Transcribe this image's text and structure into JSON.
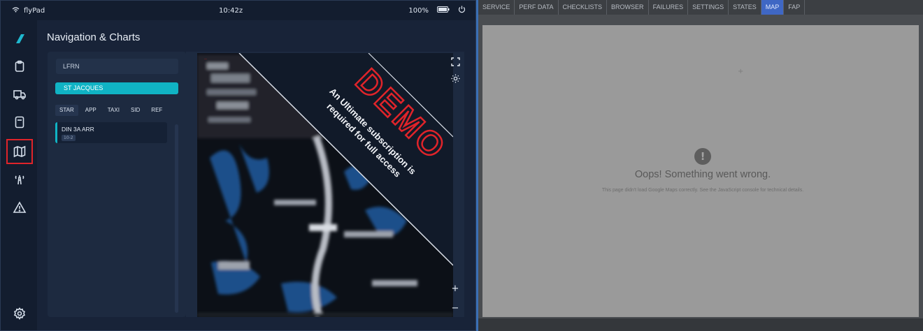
{
  "flypad": {
    "status": {
      "brand": "flyPad",
      "time": "10:42z",
      "battery": "100%"
    },
    "sidebar": {
      "items": [
        {
          "name": "dashboard"
        },
        {
          "name": "dispatch"
        },
        {
          "name": "ground"
        },
        {
          "name": "performance"
        },
        {
          "name": "navigation"
        },
        {
          "name": "atc"
        },
        {
          "name": "failures"
        },
        {
          "name": "settings"
        }
      ],
      "active_index": 4
    },
    "page_title": "Navigation & Charts",
    "search": {
      "icao": "LFRN",
      "airport": "ST JACQUES"
    },
    "chart_tabs": [
      "STAR",
      "APP",
      "TAXI",
      "SID",
      "REF"
    ],
    "active_chart_tab": 0,
    "charts": [
      {
        "name": "DIN 3A ARR",
        "ref": "10-2"
      }
    ],
    "demo": {
      "word": "DEMO",
      "line1": "An Ultimate subscription is",
      "line2": "required for full access"
    },
    "controls": {
      "zoom_in": "+",
      "zoom_out": "−"
    }
  },
  "efb": {
    "tabs": [
      "SERVICE",
      "PERF DATA",
      "CHECKLISTS",
      "BROWSER",
      "FAILURES",
      "SETTINGS",
      "STATES",
      "MAP",
      "FAP"
    ],
    "active_tab": "MAP",
    "error": {
      "icon": "!",
      "title": "Oops! Something went wrong.",
      "detail": "This page didn't load Google Maps correctly. See the JavaScript console for technical details."
    }
  },
  "colors": {
    "accent": "#10b3c4",
    "highlight": "#e0242a",
    "active_tab": "#3f67c4"
  }
}
